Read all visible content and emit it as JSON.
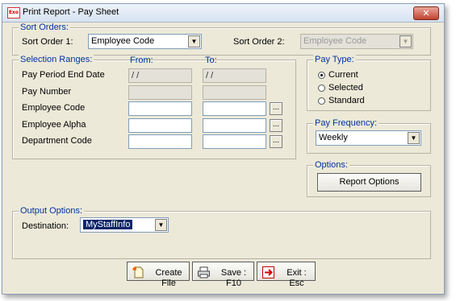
{
  "window": {
    "title": "Print Report - Pay Sheet",
    "app_icon_text": "Exo"
  },
  "sort_orders": {
    "legend": "Sort Orders:",
    "sort_order_1_label": "Sort Order 1:",
    "sort_order_1_value": "Employee Code",
    "sort_order_2_label": "Sort Order 2:",
    "sort_order_2_value": "Employee Code"
  },
  "selection": {
    "legend": "Selection Ranges:",
    "from_label": "From:",
    "to_label": "To:",
    "rows": [
      {
        "label": "Pay Period End Date",
        "from": "/ /",
        "to": "/ /"
      },
      {
        "label": "Pay Number",
        "from": "",
        "to": ""
      },
      {
        "label": "Employee Code",
        "from": "",
        "to": "",
        "lookup": "..."
      },
      {
        "label": "Employee Alpha",
        "from": "",
        "to": "",
        "lookup": "..."
      },
      {
        "label": "Department Code",
        "from": "",
        "to": "",
        "lookup": "..."
      }
    ]
  },
  "pay_type": {
    "legend": "Pay Type:",
    "options": [
      {
        "label": "Current",
        "selected": true
      },
      {
        "label": "Selected",
        "selected": false
      },
      {
        "label": "Standard",
        "selected": false
      }
    ]
  },
  "pay_frequency": {
    "legend": "Pay Frequency:",
    "value": "Weekly"
  },
  "options": {
    "legend": "Options:",
    "button": "Report Options"
  },
  "output": {
    "legend": "Output Options:",
    "destination_label": "Destination:",
    "destination_value": "MyStaffInfo"
  },
  "footer": {
    "create_file": "Create File",
    "save": "Save : F10",
    "exit": "Exit : Esc"
  }
}
